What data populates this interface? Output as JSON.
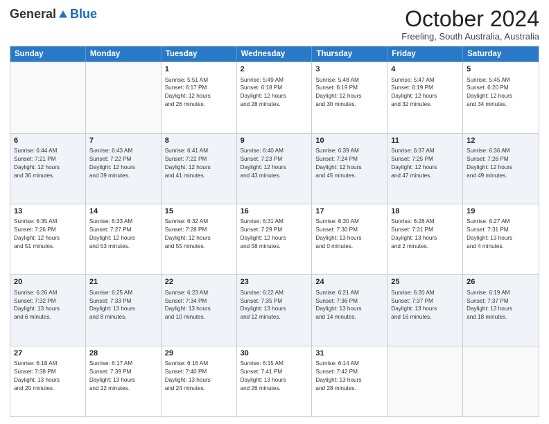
{
  "header": {
    "logo_general": "General",
    "logo_blue": "Blue",
    "month_title": "October 2024",
    "location": "Freeling, South Australia, Australia"
  },
  "days_of_week": [
    "Sunday",
    "Monday",
    "Tuesday",
    "Wednesday",
    "Thursday",
    "Friday",
    "Saturday"
  ],
  "weeks": [
    [
      {
        "day": "",
        "lines": []
      },
      {
        "day": "",
        "lines": []
      },
      {
        "day": "1",
        "lines": [
          "Sunrise: 5:51 AM",
          "Sunset: 6:17 PM",
          "Daylight: 12 hours",
          "and 26 minutes."
        ]
      },
      {
        "day": "2",
        "lines": [
          "Sunrise: 5:49 AM",
          "Sunset: 6:18 PM",
          "Daylight: 12 hours",
          "and 28 minutes."
        ]
      },
      {
        "day": "3",
        "lines": [
          "Sunrise: 5:48 AM",
          "Sunset: 6:19 PM",
          "Daylight: 12 hours",
          "and 30 minutes."
        ]
      },
      {
        "day": "4",
        "lines": [
          "Sunrise: 5:47 AM",
          "Sunset: 6:19 PM",
          "Daylight: 12 hours",
          "and 32 minutes."
        ]
      },
      {
        "day": "5",
        "lines": [
          "Sunrise: 5:45 AM",
          "Sunset: 6:20 PM",
          "Daylight: 12 hours",
          "and 34 minutes."
        ]
      }
    ],
    [
      {
        "day": "6",
        "lines": [
          "Sunrise: 6:44 AM",
          "Sunset: 7:21 PM",
          "Daylight: 12 hours",
          "and 36 minutes."
        ]
      },
      {
        "day": "7",
        "lines": [
          "Sunrise: 6:43 AM",
          "Sunset: 7:22 PM",
          "Daylight: 12 hours",
          "and 39 minutes."
        ]
      },
      {
        "day": "8",
        "lines": [
          "Sunrise: 6:41 AM",
          "Sunset: 7:22 PM",
          "Daylight: 12 hours",
          "and 41 minutes."
        ]
      },
      {
        "day": "9",
        "lines": [
          "Sunrise: 6:40 AM",
          "Sunset: 7:23 PM",
          "Daylight: 12 hours",
          "and 43 minutes."
        ]
      },
      {
        "day": "10",
        "lines": [
          "Sunrise: 6:39 AM",
          "Sunset: 7:24 PM",
          "Daylight: 12 hours",
          "and 45 minutes."
        ]
      },
      {
        "day": "11",
        "lines": [
          "Sunrise: 6:37 AM",
          "Sunset: 7:25 PM",
          "Daylight: 12 hours",
          "and 47 minutes."
        ]
      },
      {
        "day": "12",
        "lines": [
          "Sunrise: 6:36 AM",
          "Sunset: 7:26 PM",
          "Daylight: 12 hours",
          "and 49 minutes."
        ]
      }
    ],
    [
      {
        "day": "13",
        "lines": [
          "Sunrise: 6:35 AM",
          "Sunset: 7:26 PM",
          "Daylight: 12 hours",
          "and 51 minutes."
        ]
      },
      {
        "day": "14",
        "lines": [
          "Sunrise: 6:33 AM",
          "Sunset: 7:27 PM",
          "Daylight: 12 hours",
          "and 53 minutes."
        ]
      },
      {
        "day": "15",
        "lines": [
          "Sunrise: 6:32 AM",
          "Sunset: 7:28 PM",
          "Daylight: 12 hours",
          "and 55 minutes."
        ]
      },
      {
        "day": "16",
        "lines": [
          "Sunrise: 6:31 AM",
          "Sunset: 7:29 PM",
          "Daylight: 12 hours",
          "and 58 minutes."
        ]
      },
      {
        "day": "17",
        "lines": [
          "Sunrise: 6:30 AM",
          "Sunset: 7:30 PM",
          "Daylight: 13 hours",
          "and 0 minutes."
        ]
      },
      {
        "day": "18",
        "lines": [
          "Sunrise: 6:28 AM",
          "Sunset: 7:31 PM",
          "Daylight: 13 hours",
          "and 2 minutes."
        ]
      },
      {
        "day": "19",
        "lines": [
          "Sunrise: 6:27 AM",
          "Sunset: 7:31 PM",
          "Daylight: 13 hours",
          "and 4 minutes."
        ]
      }
    ],
    [
      {
        "day": "20",
        "lines": [
          "Sunrise: 6:26 AM",
          "Sunset: 7:32 PM",
          "Daylight: 13 hours",
          "and 6 minutes."
        ]
      },
      {
        "day": "21",
        "lines": [
          "Sunrise: 6:25 AM",
          "Sunset: 7:33 PM",
          "Daylight: 13 hours",
          "and 8 minutes."
        ]
      },
      {
        "day": "22",
        "lines": [
          "Sunrise: 6:23 AM",
          "Sunset: 7:34 PM",
          "Daylight: 13 hours",
          "and 10 minutes."
        ]
      },
      {
        "day": "23",
        "lines": [
          "Sunrise: 6:22 AM",
          "Sunset: 7:35 PM",
          "Daylight: 13 hours",
          "and 12 minutes."
        ]
      },
      {
        "day": "24",
        "lines": [
          "Sunrise: 6:21 AM",
          "Sunset: 7:36 PM",
          "Daylight: 13 hours",
          "and 14 minutes."
        ]
      },
      {
        "day": "25",
        "lines": [
          "Sunrise: 6:20 AM",
          "Sunset: 7:37 PM",
          "Daylight: 13 hours",
          "and 16 minutes."
        ]
      },
      {
        "day": "26",
        "lines": [
          "Sunrise: 6:19 AM",
          "Sunset: 7:37 PM",
          "Daylight: 13 hours",
          "and 18 minutes."
        ]
      }
    ],
    [
      {
        "day": "27",
        "lines": [
          "Sunrise: 6:18 AM",
          "Sunset: 7:38 PM",
          "Daylight: 13 hours",
          "and 20 minutes."
        ]
      },
      {
        "day": "28",
        "lines": [
          "Sunrise: 6:17 AM",
          "Sunset: 7:39 PM",
          "Daylight: 13 hours",
          "and 22 minutes."
        ]
      },
      {
        "day": "29",
        "lines": [
          "Sunrise: 6:16 AM",
          "Sunset: 7:40 PM",
          "Daylight: 13 hours",
          "and 24 minutes."
        ]
      },
      {
        "day": "30",
        "lines": [
          "Sunrise: 6:15 AM",
          "Sunset: 7:41 PM",
          "Daylight: 13 hours",
          "and 26 minutes."
        ]
      },
      {
        "day": "31",
        "lines": [
          "Sunrise: 6:14 AM",
          "Sunset: 7:42 PM",
          "Daylight: 13 hours",
          "and 28 minutes."
        ]
      },
      {
        "day": "",
        "lines": []
      },
      {
        "day": "",
        "lines": []
      }
    ]
  ]
}
